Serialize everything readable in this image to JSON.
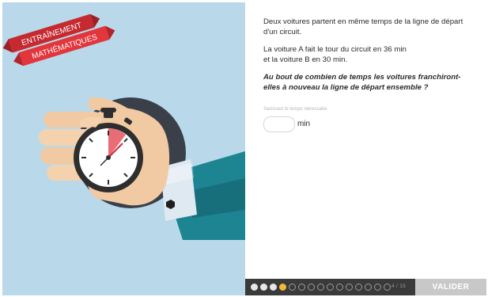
{
  "banner": {
    "line1": "ENTRAÎNEMENT",
    "line2": "MATHÉMATIQUES"
  },
  "question": {
    "intro": "Deux voitures partent en même temps de la ligne de départ d'un circuit.",
    "details_line1": "La voiture A fait le tour du circuit en 36 min",
    "details_line2": "et la voiture B en 30 min.",
    "prompt": "Au bout de combien de temps les voitures franchiront-elles à nouveau la ligne de départ ensemble ?"
  },
  "answer": {
    "hint": "Saisissez le temps nécessaire.",
    "value": "",
    "unit": "min"
  },
  "progress": {
    "current": 4,
    "total": 15,
    "label": "4 / 15"
  },
  "footer": {
    "validate_label": "VALIDER"
  },
  "colors": {
    "sky": "#b9d9ea",
    "ribbon": "#e2353c",
    "accent": "#f1b935",
    "sleeve": "#1d8592"
  },
  "illustration": {
    "icon": "stopwatch-hand-icon"
  }
}
